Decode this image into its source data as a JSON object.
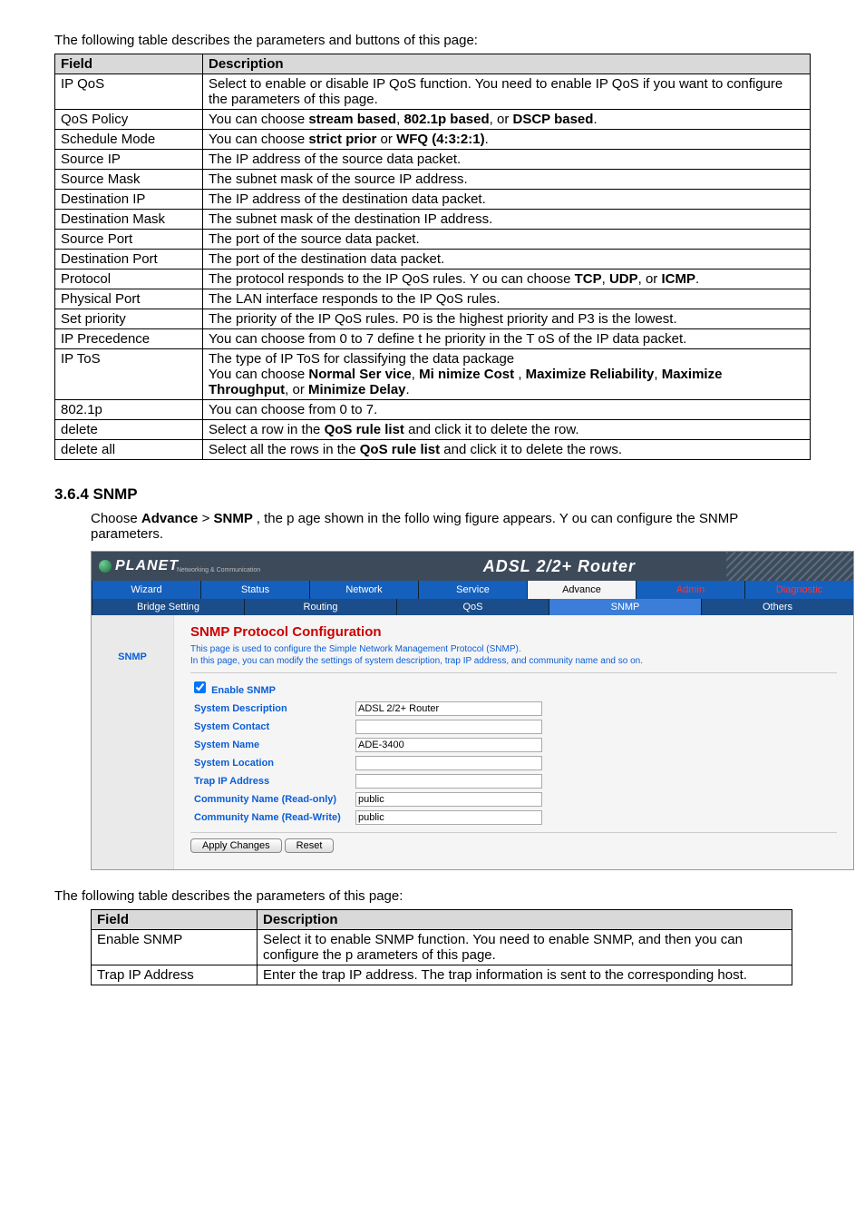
{
  "intro1": "The following table describes the parameters and buttons of this page:",
  "table1": {
    "field_h": "Field",
    "desc_h": "Description",
    "rows": [
      {
        "f": "IP QoS",
        "d": "Select to enable or disable IP  QoS function. You need to enable IP QoS if you want to configure the parameters of this page."
      },
      {
        "f": "QoS Policy",
        "d_pre": "You can choose ",
        "b1": "stream based",
        "sep1": ", ",
        "b2": "802.1p based",
        "sep2": ", or ",
        "b3": "DSCP based",
        "tail": "."
      },
      {
        "f": "Schedule Mode",
        "d_pre": "You can choose ",
        "b1": "strict prior",
        "sep1": " or ",
        "b2": "WFQ (4:3:2:1)",
        "tail": "."
      },
      {
        "f": "Source IP",
        "d": "The IP address of the source data packet."
      },
      {
        "f": "Source Mask",
        "d": "The subnet mask of the source IP address."
      },
      {
        "f": "Destination IP",
        "d": "The IP address of the destination data packet."
      },
      {
        "f": "Destination Mask",
        "d": "The subnet mask of the destination IP address."
      },
      {
        "f": "Source Port",
        "d": "The port of the source data packet."
      },
      {
        "f": "Destination Port",
        "d": "The port of the destination data packet."
      },
      {
        "f": "Protocol",
        "d_pre": "The protocol responds to the   IP QoS rules. Y ou can choose  ",
        "b1": "TCP",
        "sep1": ", ",
        "b2": "UDP",
        "sep2": ", or ",
        "b3": "ICMP",
        "tail": "."
      },
      {
        "f": "Physical Port",
        "d": "The LAN interface responds to the IP QoS rules."
      },
      {
        "f": "Set priority",
        "d": "The priority of the IP  QoS rules. P0  is the highest priority and P3 is the lowest."
      },
      {
        "f": "IP Precedence",
        "d": "You can choose from 0 to 7 define t  he priority in the T oS of the IP data packet."
      },
      {
        "f": "IP ToS",
        "d_pre": "The type of IP ToS for classifying the data package\nYou can choose      ",
        "b1": "Normal Ser  vice",
        "sep1": ", ",
        "b2": "Mi nimize Cost ",
        "sep2": ", ",
        "b3": "Maximize Reliability",
        "sep3": ", ",
        "b4": "Maximize Throughput",
        "sep4": ", or ",
        "b5": "Minimize Delay",
        "tail": "."
      },
      {
        "f": "802.1p",
        "d": "You can choose from 0 to 7."
      },
      {
        "f": "delete",
        "d_pre": "Select a row in the ",
        "b1": "QoS rule list",
        "tail": " and click it to delete the row."
      },
      {
        "f": "delete all",
        "d_pre": "Select all the rows in the ",
        "b1": "QoS rule list",
        "tail": " and click it to delete the rows."
      }
    ]
  },
  "section": "3.6.4 SNMP",
  "para_pre": "Choose ",
  "para_b1": "Advance ",
  "para_gt": " > ",
  "para_b2": "SNMP ",
  "para_tail": ", the p age shown in the follo   wing figure appears. Y  ou can configure the SNMP parameters.",
  "ss": {
    "logo": "PLANET",
    "logo_sub": "Networking & Communication",
    "title_router": "ADSL 2/2+ Router",
    "tabs": [
      "Wizard",
      "Status",
      "Network",
      "Service",
      "Advance",
      "Admin",
      "Diagnostic"
    ],
    "subtabs": [
      "Bridge Setting",
      "Routing",
      "QoS",
      "SNMP",
      "Others"
    ],
    "side": "SNMP",
    "cfg_title": "SNMP Protocol Configuration",
    "cfg_desc": "This page is used to configure the Simple Network Management Protocol (SNMP).\nIn this page, you can modify the settings of system description, trap IP address, and community name and so on.",
    "enable": "Enable SNMP",
    "rows": [
      {
        "l": "System Description",
        "v": "ADSL 2/2+ Router"
      },
      {
        "l": "System Contact",
        "v": ""
      },
      {
        "l": "System Name",
        "v": "ADE-3400"
      },
      {
        "l": "System Location",
        "v": ""
      },
      {
        "l": "Trap IP Address",
        "v": ""
      },
      {
        "l": "Community Name (Read-only)",
        "v": "public"
      },
      {
        "l": "Community Name (Read-Write)",
        "v": "public"
      }
    ],
    "btn_apply": "Apply Changes",
    "btn_reset": "Reset"
  },
  "intro2": "The following table describes the parameters of this page:",
  "table2": {
    "field_h": "Field",
    "desc_h": "Description",
    "rows": [
      {
        "f": "Enable SNMP",
        "d": "Select it to enable SNMP  function. You need to enable SNMP, and then you can configure the p   arameters of this page."
      },
      {
        "f": "Trap IP Address",
        "d": "Enter the trap IP  address. The trap information is sent to the corresponding host."
      }
    ]
  }
}
